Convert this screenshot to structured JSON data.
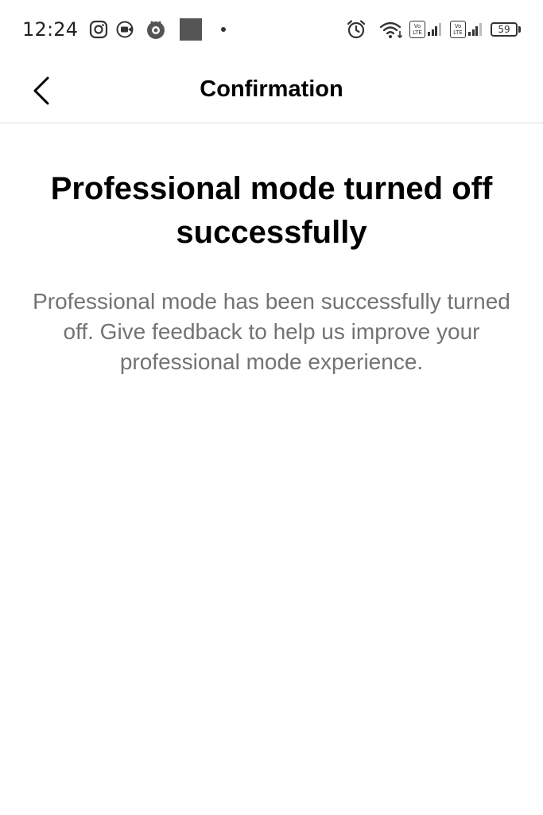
{
  "status_bar": {
    "time": "12:24",
    "icons_left": [
      "instagram-icon",
      "video-call-icon",
      "app-notification-icon",
      "gallery-thumbnail",
      "more-dot"
    ],
    "icons_right": [
      "alarm-icon",
      "wifi-icon",
      "volte-icon",
      "signal-icon",
      "volte-icon",
      "signal-icon",
      "battery-icon"
    ],
    "volte_label_top": "Vo",
    "volte_label_bottom": "LTE",
    "battery_level": "59"
  },
  "header": {
    "title": "Confirmation",
    "back_icon": "chevron-left-icon"
  },
  "main": {
    "headline": "Professional mode turned off successfully",
    "description": "Professional mode has been successfully turned off. Give feedback to help us improve your professional mode experience."
  },
  "colors": {
    "background": "#ffffff",
    "text_primary": "#000000",
    "text_secondary": "#737373",
    "divider": "#dbdbdb"
  }
}
